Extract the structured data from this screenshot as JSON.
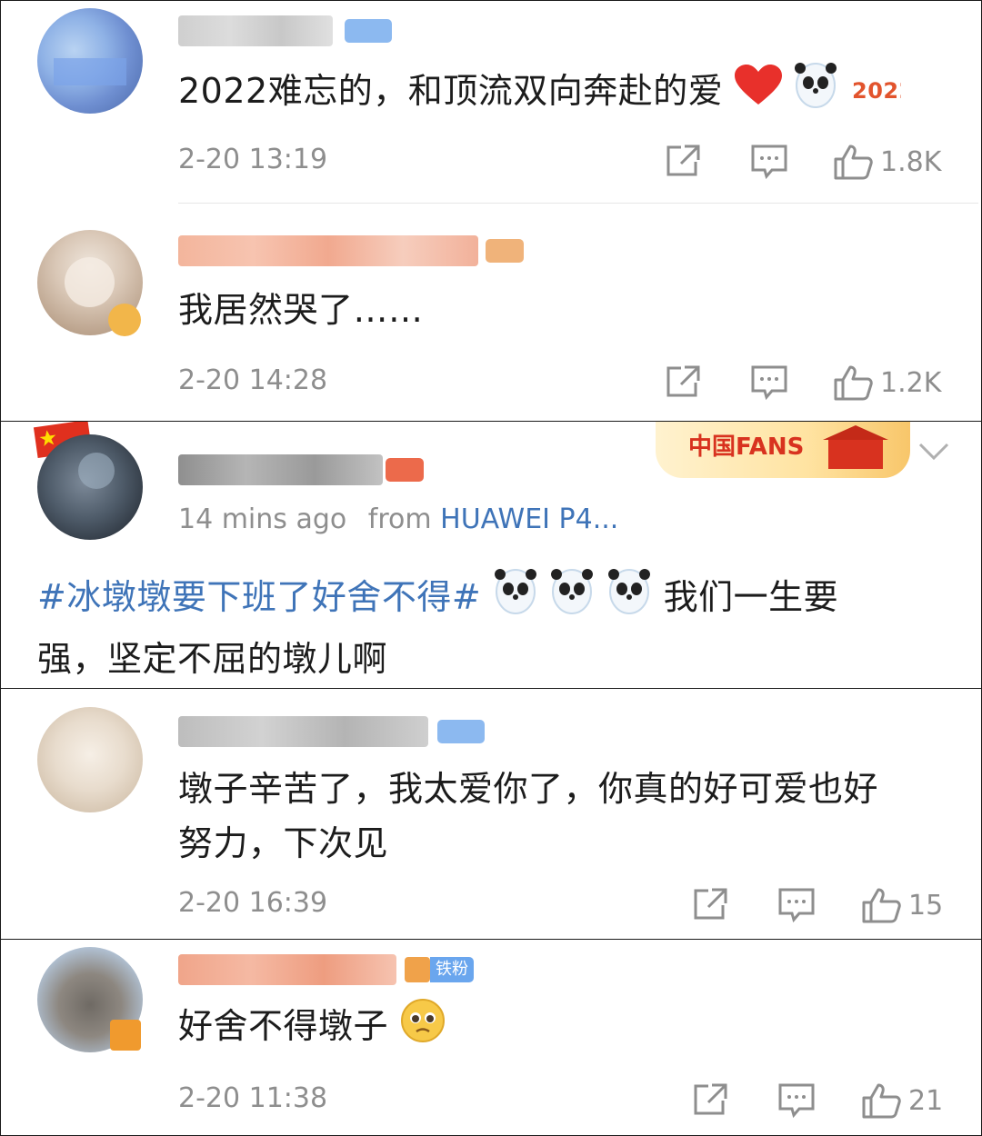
{
  "comments": [
    {
      "text": "2022难忘的，和顶流双向奔赴的爱",
      "time": "2-20 13:19",
      "likes": "1.8K",
      "emoji_icons": [
        "heart-icon",
        "bing-dwen-dwen-icon",
        "2022-sticker-icon"
      ]
    },
    {
      "text": "我居然哭了……",
      "time": "2-20 14:28",
      "likes": "1.2K"
    }
  ],
  "post": {
    "time_ago": "14 mins ago",
    "from_label": "from",
    "device": "HUAWEI P4...",
    "hashtag": "#冰墩墩要下班了好舍不得#",
    "text_line1_tail": "我们一生要",
    "text_line2": "强，坚定不屈的墩儿啊",
    "badge_icon": "china-fans-badge-icon"
  },
  "comments_b": [
    {
      "text_line1": "墩子辛苦了，我太爱你了，你真的好可爱也好",
      "text_line2": "努力，下次见",
      "time": "2-20 16:39",
      "likes": "15"
    },
    {
      "text": "好舍不得墩子",
      "time": "2-20 11:38",
      "likes": "21",
      "fan_badge": "铁粉",
      "emoji_icons": [
        "pleading-face-icon"
      ]
    }
  ],
  "colors": {
    "link_blue": "#3f74b8",
    "meta_gray": "#8e8e8e",
    "badge_blue": "#6aa6ee",
    "orange_name": "#f08a5d"
  }
}
